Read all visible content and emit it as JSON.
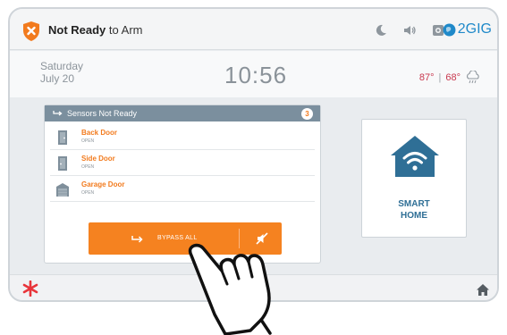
{
  "status_bar": {
    "status_bold": "Not Ready",
    "status_rest": " to Arm",
    "brand": "2GIG",
    "icons": [
      "moon-icon",
      "volume-icon",
      "camera-icon",
      "globe-icon"
    ]
  },
  "info": {
    "weekday": "Saturday",
    "date": "July 20",
    "time": "10:56",
    "temp_high": "87°",
    "temp_sep": "|",
    "temp_low": "68°"
  },
  "sensors": {
    "title": "Sensors Not Ready",
    "count": "3",
    "items": [
      {
        "name": "Back Door",
        "state": "OPEN"
      },
      {
        "name": "Side Door",
        "state": "OPEN"
      },
      {
        "name": "Garage Door",
        "state": "OPEN"
      }
    ],
    "bypass_label": "BYPASS ALL"
  },
  "smart_home": {
    "line1": "SMART",
    "line2": "HOME"
  },
  "colors": {
    "accent_orange": "#f58220",
    "header_gray": "#7b8f9e",
    "smart_blue": "#2f6f96",
    "temp_red": "#c8394f",
    "brand_blue": "#1f89c9"
  }
}
